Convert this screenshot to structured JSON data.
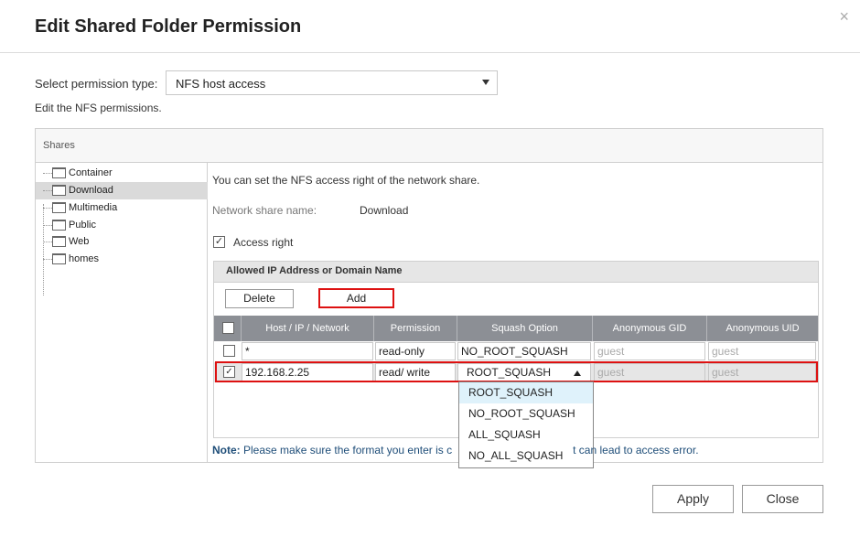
{
  "dialog": {
    "title": "Edit Shared Folder Permission",
    "close_glyph": "×"
  },
  "permission_type": {
    "label": "Select permission type:",
    "selected": "NFS host access",
    "note": "Edit the NFS permissions."
  },
  "shares": {
    "header": "Shares",
    "tree": [
      "Container",
      "Download",
      "Multimedia",
      "Public",
      "Web",
      "homes"
    ],
    "selected": "Download"
  },
  "nfs": {
    "info": "You can set the NFS access right of the network share.",
    "share_name_label": "Network share name:",
    "share_name_value": "Download",
    "access_right_label": "Access right",
    "access_right_checked": true,
    "grid_title": "Allowed IP Address or Domain Name",
    "delete_label": "Delete",
    "add_label": "Add",
    "columns": [
      "Host / IP / Network",
      "Permission",
      "Squash Option",
      "Anonymous GID",
      "Anonymous UID"
    ],
    "rows": [
      {
        "checked": false,
        "host": "*",
        "permission": "read-only",
        "squash": "NO_ROOT_SQUASH",
        "gid": "guest",
        "uid": "guest"
      },
      {
        "checked": true,
        "host": "192.168.2.25",
        "permission": "read/ write",
        "squash": "ROOT_SQUASH",
        "gid": "guest",
        "uid": "guest"
      }
    ],
    "squash_options": [
      "ROOT_SQUASH",
      "NO_ROOT_SQUASH",
      "ALL_SQUASH",
      "NO_ALL_SQUASH"
    ],
    "note_prefix": "Note:",
    "note_left": "Please make sure the format you enter is c",
    "note_right": "t can lead to access error."
  },
  "footer": {
    "apply_label": "Apply",
    "close_label": "Close"
  },
  "colors": {
    "highlight_red": "#dd1111",
    "header_gray": "#8c8f95",
    "note_blue": "#1f4e79",
    "dropdown_hover": "#dff2fb"
  }
}
